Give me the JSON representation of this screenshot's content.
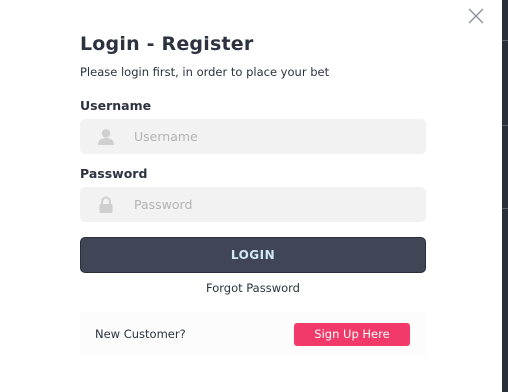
{
  "modal": {
    "title": "Login - Register",
    "subtitle": "Please login first, in order to place your bet",
    "close_icon": "close-icon"
  },
  "username": {
    "label": "Username",
    "placeholder": "Username",
    "value": "",
    "icon": "user-icon"
  },
  "password": {
    "label": "Password",
    "placeholder": "Password",
    "value": "",
    "icon": "lock-icon"
  },
  "login_button": {
    "label": "LOGIN"
  },
  "forgot_password": {
    "label": "Forgot Password"
  },
  "signup": {
    "prompt": "New Customer?",
    "button_label": "Sign Up Here"
  },
  "colors": {
    "login_button_bg": "#404656",
    "login_button_text": "#cfe9f3",
    "signup_button_bg": "#f23a6a",
    "input_bg": "#f2f2f2",
    "text": "#2d3240"
  }
}
